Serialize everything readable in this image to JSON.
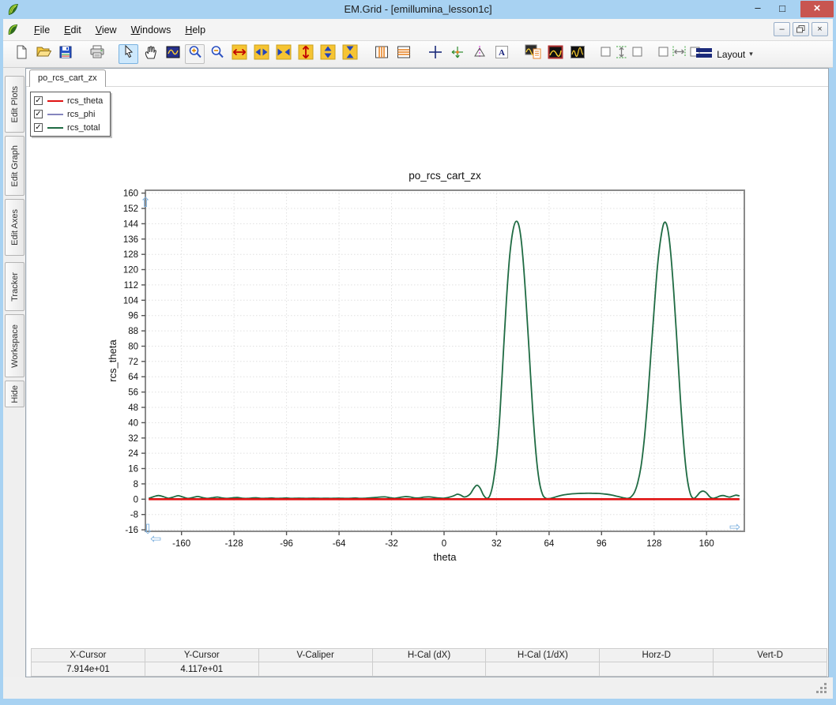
{
  "window": {
    "title": "EM.Grid - [emillumina_lesson1c]",
    "controls": {
      "minimize": "–",
      "maximize": "□",
      "close": "×"
    },
    "mdi_controls": {
      "minimize": "–",
      "restore": "restore-icon",
      "close": "×"
    },
    "colors": {
      "titlebar": "#a8d2f2",
      "close_button": "#c85550",
      "toolbar_selected": "#cde8fc"
    }
  },
  "menu": {
    "items": [
      {
        "label": "File"
      },
      {
        "label": "Edit"
      },
      {
        "label": "View"
      },
      {
        "label": "Windows"
      },
      {
        "label": "Help"
      }
    ]
  },
  "toolbar": {
    "groups": [
      [
        "new-file",
        "open-file",
        "save-file"
      ],
      [
        "print"
      ],
      [
        "select-pointer",
        "pan-hand",
        "zoom-plot",
        "zoom-in",
        "zoom-out",
        "expand-x-red",
        "expand-x-blue",
        "shrink-x-blue",
        "expand-y-red",
        "expand-y-blue",
        "shrink-y-blue"
      ],
      [
        "stripes-v",
        "stripes-h"
      ],
      [
        "cross-cursor",
        "tracker",
        "caliper",
        "text-note"
      ],
      [
        "wave-report",
        "wave-red-frame",
        "wave-double"
      ],
      [
        "distribute-v"
      ],
      [
        "distribute-h"
      ],
      [
        "layout"
      ]
    ],
    "selected": "select-pointer",
    "framed": "zoom-in",
    "layout_label": "Layout"
  },
  "sidebar": {
    "tabs": [
      "Edit Plots",
      "Edit Graph",
      "Edit Axes",
      "Tracker",
      "Workspace",
      "Hide"
    ]
  },
  "document_tab": "po_rcs_cart_zx",
  "legend": {
    "items": [
      {
        "label": "rcs_theta",
        "checked": true
      },
      {
        "label": "rcs_phi",
        "checked": true
      },
      {
        "label": "rcs_total",
        "checked": true
      }
    ]
  },
  "chart_data": {
    "type": "line",
    "title": "po_rcs_cart_zx",
    "xlabel": "theta",
    "ylabel": "rcs_theta",
    "xlim": [
      -182,
      183
    ],
    "ylim": [
      -16.8,
      161.5
    ],
    "xticks": [
      -160,
      -128,
      -96,
      -64,
      -32,
      0,
      32,
      64,
      96,
      128,
      160
    ],
    "yticks": [
      -16,
      -8,
      0,
      8,
      16,
      24,
      32,
      40,
      48,
      56,
      64,
      72,
      80,
      88,
      96,
      104,
      112,
      120,
      128,
      136,
      144,
      152,
      160
    ],
    "grid": true,
    "grid_color": "#e0e0e0",
    "frame_color": "#8a8a8a",
    "legend_position": "top-left-floating",
    "series": [
      {
        "name": "rcs_phi",
        "color": "#8585bd",
        "width": 1.6,
        "points": [
          [
            -180,
            0
          ],
          [
            180,
            0
          ]
        ]
      },
      {
        "name": "rcs_total",
        "color": "#1f6b43",
        "width": 1.8,
        "points": [
          [
            -180,
            0.4
          ],
          [
            -177,
            1.3
          ],
          [
            -174,
            1.9
          ],
          [
            -171,
            1.3
          ],
          [
            -168,
            0.5
          ],
          [
            -165,
            1.1
          ],
          [
            -162,
            1.8
          ],
          [
            -159,
            1.1
          ],
          [
            -156,
            0.4
          ],
          [
            -153,
            0.9
          ],
          [
            -150,
            1.4
          ],
          [
            -147,
            0.8
          ],
          [
            -144,
            0.4
          ],
          [
            -141,
            0.8
          ],
          [
            -138,
            1.1
          ],
          [
            -135,
            0.6
          ],
          [
            -132,
            0.4
          ],
          [
            -129,
            0.7
          ],
          [
            -126,
            0.9
          ],
          [
            -123,
            0.5
          ],
          [
            -120,
            0.4
          ],
          [
            -117,
            0.6
          ],
          [
            -114,
            0.7
          ],
          [
            -111,
            0.4
          ],
          [
            -108,
            0.5
          ],
          [
            -105,
            0.6
          ],
          [
            -102,
            0.4
          ],
          [
            -99,
            0.5
          ],
          [
            -96,
            0.6
          ],
          [
            -93,
            0.4
          ],
          [
            -90,
            0.5
          ],
          [
            -87,
            0.5
          ],
          [
            -84,
            0.4
          ],
          [
            -81,
            0.5
          ],
          [
            -78,
            0.5
          ],
          [
            -75,
            0.4
          ],
          [
            -72,
            0.5
          ],
          [
            -69,
            0.4
          ],
          [
            -66,
            0.5
          ],
          [
            -63,
            0.5
          ],
          [
            -60,
            0.4
          ],
          [
            -57,
            0.5
          ],
          [
            -54,
            0.6
          ],
          [
            -51,
            0.4
          ],
          [
            -48,
            0.5
          ],
          [
            -45,
            0.7
          ],
          [
            -42,
            0.9
          ],
          [
            -39,
            1.1
          ],
          [
            -36,
            1.2
          ],
          [
            -33,
            0.8
          ],
          [
            -30,
            0.5
          ],
          [
            -27,
            0.9
          ],
          [
            -24,
            1.3
          ],
          [
            -21,
            1.2
          ],
          [
            -18,
            0.7
          ],
          [
            -15,
            0.7
          ],
          [
            -12,
            1.1
          ],
          [
            -9,
            1.2
          ],
          [
            -6,
            0.9
          ],
          [
            -3,
            0.6
          ],
          [
            0,
            0.5
          ],
          [
            3,
            1.0
          ],
          [
            6,
            1.8
          ],
          [
            8,
            2.6
          ],
          [
            10,
            2.2
          ],
          [
            12,
            1.2
          ],
          [
            14,
            1.5
          ],
          [
            16,
            2.8
          ],
          [
            18,
            5.5
          ],
          [
            20,
            7.3
          ],
          [
            22,
            5.8
          ],
          [
            24,
            2.2
          ],
          [
            26,
            0.4
          ],
          [
            28,
            2
          ],
          [
            30,
            9
          ],
          [
            32,
            22
          ],
          [
            34,
            44
          ],
          [
            36,
            74
          ],
          [
            38,
            104
          ],
          [
            40,
            127
          ],
          [
            42,
            140.5
          ],
          [
            44,
            145.3
          ],
          [
            46,
            141.5
          ],
          [
            48,
            127
          ],
          [
            50,
            103
          ],
          [
            52,
            75
          ],
          [
            54,
            47
          ],
          [
            56,
            24
          ],
          [
            58,
            9.5
          ],
          [
            60,
            2.5
          ],
          [
            62,
            0.5
          ],
          [
            64,
            0.3
          ],
          [
            67,
            0.9
          ],
          [
            70,
            1.7
          ],
          [
            74,
            2.4
          ],
          [
            78,
            2.8
          ],
          [
            82,
            3.0
          ],
          [
            86,
            3.1
          ],
          [
            90,
            3.1
          ],
          [
            94,
            3.0
          ],
          [
            98,
            2.7
          ],
          [
            102,
            2.2
          ],
          [
            106,
            1.4
          ],
          [
            110,
            0.6
          ],
          [
            112,
            0.4
          ],
          [
            114,
            1.2
          ],
          [
            116,
            3.5
          ],
          [
            118,
            8.5
          ],
          [
            120,
            17
          ],
          [
            122,
            31
          ],
          [
            124,
            51
          ],
          [
            126,
            75
          ],
          [
            128,
            99
          ],
          [
            130,
            121
          ],
          [
            132,
            136
          ],
          [
            134,
            144.3
          ],
          [
            136,
            142.5
          ],
          [
            138,
            130
          ],
          [
            140,
            108
          ],
          [
            142,
            81
          ],
          [
            144,
            53
          ],
          [
            146,
            29
          ],
          [
            148,
            12
          ],
          [
            150,
            3
          ],
          [
            152,
            0.4
          ],
          [
            154,
            1.6
          ],
          [
            156,
            3.6
          ],
          [
            158,
            4.2
          ],
          [
            160,
            3.2
          ],
          [
            162,
            1.2
          ],
          [
            164,
            0.4
          ],
          [
            166,
            0.9
          ],
          [
            168,
            1.6
          ],
          [
            170,
            1.9
          ],
          [
            172,
            1.5
          ],
          [
            174,
            1.1
          ],
          [
            176,
            1.6
          ],
          [
            178,
            2.1
          ],
          [
            180,
            1.7
          ]
        ]
      },
      {
        "name": "rcs_theta",
        "color": "#e01212",
        "width": 2.6,
        "points": [
          [
            -180,
            0
          ],
          [
            180,
            0
          ]
        ]
      }
    ]
  },
  "status_table": {
    "columns": [
      "X-Cursor",
      "Y-Cursor",
      "V-Caliper",
      "H-Cal (dX)",
      "H-Cal (1/dX)",
      "Horz-D",
      "Vert-D"
    ],
    "values": [
      "7.914e+01",
      "4.117e+01",
      "",
      "",
      "",
      "",
      ""
    ]
  }
}
